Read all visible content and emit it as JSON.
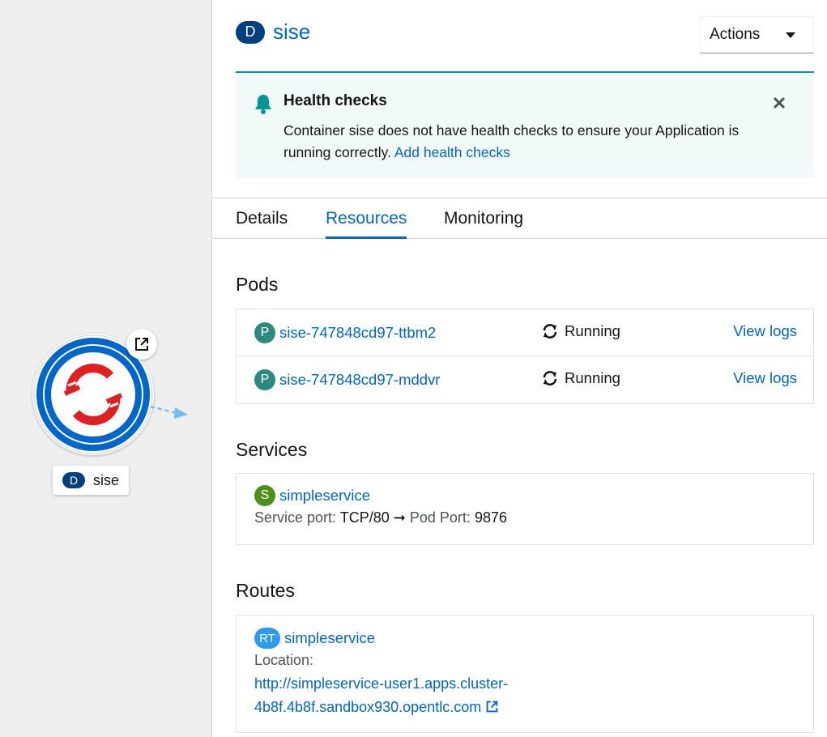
{
  "topology": {
    "node": {
      "kind_badge": "D",
      "name": "sise"
    }
  },
  "panel": {
    "kind_badge": "D",
    "title": "sise",
    "actions_label": "Actions"
  },
  "alert": {
    "title": "Health checks",
    "message": "Container sise does not have health checks to ensure your Application is running correctly.",
    "link": "Add health checks"
  },
  "tabs": [
    {
      "label": "Details"
    },
    {
      "label": "Resources"
    },
    {
      "label": "Monitoring"
    }
  ],
  "active_tab": "Resources",
  "pods": {
    "title": "Pods",
    "items": [
      {
        "badge": "P",
        "name": "sise-747848cd97-ttbm2",
        "status": "Running",
        "action": "View logs"
      },
      {
        "badge": "P",
        "name": "sise-747848cd97-mddvr",
        "status": "Running",
        "action": "View logs"
      }
    ]
  },
  "services": {
    "title": "Services",
    "items": [
      {
        "badge": "S",
        "name": "simpleservice",
        "port_label": "Service port:",
        "port_value": "TCP/80",
        "arrow": "➞",
        "pod_port_label": "Pod Port:",
        "pod_port_value": "9876"
      }
    ]
  },
  "routes": {
    "title": "Routes",
    "items": [
      {
        "badge": "RT",
        "name": "simpleservice",
        "location_label": "Location:",
        "url_line1": "http://simpleservice-user1.apps.cluster-",
        "url_line2": "4b8f.4b8f.sandbox930.opentlc.com"
      }
    ]
  },
  "colors": {
    "link": "#0066cc",
    "deployment_badge": "#004080",
    "pod_badge": "#2a8a7e",
    "service_badge": "#4f8f1a",
    "route_badge": "#2b9af3",
    "alert_accent": "#009596",
    "openshift_red": "#e02020",
    "ring_blue": "#0066cc"
  }
}
